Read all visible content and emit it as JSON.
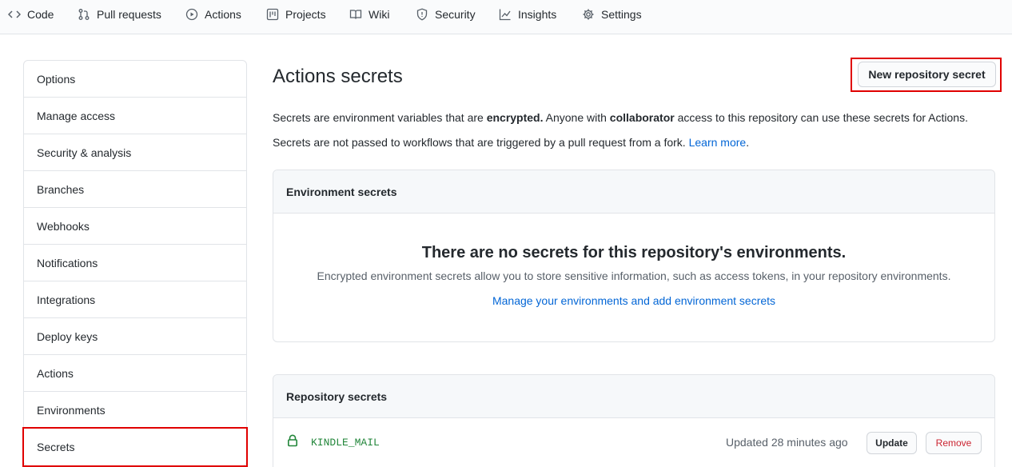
{
  "repo_nav": {
    "tabs": [
      {
        "label": "Code",
        "icon": "code-icon"
      },
      {
        "label": "Pull requests",
        "icon": "git-pull-request-icon"
      },
      {
        "label": "Actions",
        "icon": "play-icon"
      },
      {
        "label": "Projects",
        "icon": "project-icon"
      },
      {
        "label": "Wiki",
        "icon": "book-icon"
      },
      {
        "label": "Security",
        "icon": "shield-icon"
      },
      {
        "label": "Insights",
        "icon": "graph-icon"
      },
      {
        "label": "Settings",
        "icon": "gear-icon"
      }
    ]
  },
  "sidebar": {
    "items": [
      {
        "label": "Options"
      },
      {
        "label": "Manage access"
      },
      {
        "label": "Security & analysis"
      },
      {
        "label": "Branches"
      },
      {
        "label": "Webhooks"
      },
      {
        "label": "Notifications"
      },
      {
        "label": "Integrations"
      },
      {
        "label": "Deploy keys"
      },
      {
        "label": "Actions"
      },
      {
        "label": "Environments"
      },
      {
        "label": "Secrets"
      }
    ],
    "selected": "Secrets"
  },
  "main": {
    "title": "Actions secrets",
    "new_secret_button": "New repository secret",
    "description": {
      "line1_part1": "Secrets are environment variables that are ",
      "line1_bold1": "encrypted.",
      "line1_part2": " Anyone with ",
      "line1_bold2": "collaborator",
      "line1_part3": " access to this repository can use these secrets for Actions.",
      "line2_text": "Secrets are not passed to workflows that are triggered by a pull request from a fork. ",
      "line2_link": "Learn more",
      "line2_end": "."
    },
    "environment_secrets": {
      "header": "Environment secrets",
      "blank_title": "There are no secrets for this repository's environments.",
      "blank_description": "Encrypted environment secrets allow you to store sensitive information, such as access tokens, in your repository environments.",
      "blank_link": "Manage your environments and add environment secrets"
    },
    "repository_secrets": {
      "header": "Repository secrets",
      "items": [
        {
          "name": "KINDLE_MAIL",
          "updated": "Updated 28 minutes ago",
          "update_label": "Update",
          "remove_label": "Remove"
        }
      ]
    }
  },
  "colors": {
    "link": "#0366d6",
    "secret_name": "#22863a",
    "remove": "#cb2431",
    "highlight_box": "#e00000"
  }
}
